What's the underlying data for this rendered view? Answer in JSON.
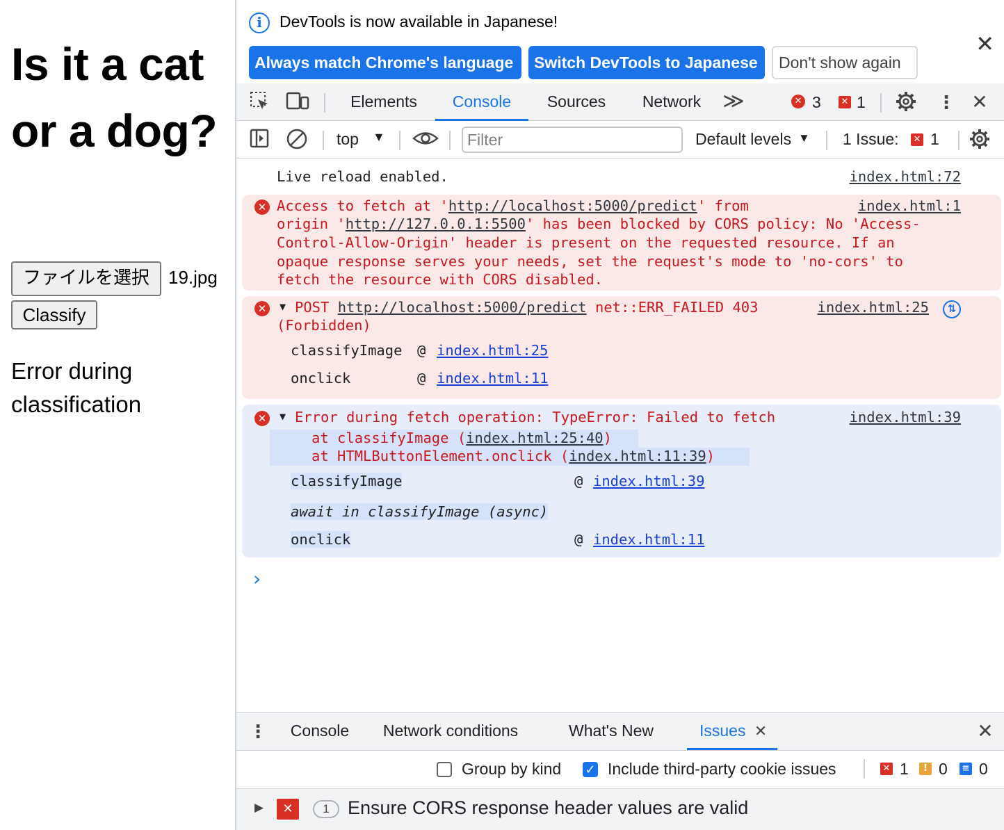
{
  "page": {
    "heading": "Is it a cat or a dog?",
    "file_button": "ファイルを選択",
    "file_name": "19.jpg",
    "classify_button": "Classify",
    "result": "Error during classification"
  },
  "infobar": {
    "message": "DevTools is now available in Japanese!",
    "btn_match": "Always match Chrome's language",
    "btn_switch": "Switch DevTools to Japanese",
    "btn_dont_show": "Don't show again"
  },
  "main_tabs": {
    "elements": "Elements",
    "console": "Console",
    "sources": "Sources",
    "network": "Network",
    "more": "≫",
    "error_count": "3",
    "issue_count": "1"
  },
  "console_toolbar": {
    "context": "top",
    "filter_placeholder": "Filter",
    "levels": "Default levels",
    "issues_label": "1 Issue:",
    "issues_count": "1"
  },
  "console": {
    "live_reload": "Live reload enabled.",
    "live_reload_src": "index.html:72",
    "cors": {
      "src": "index.html:1",
      "l1a": "Access to fetch at '",
      "l1url": "http://localhost:5000/predict",
      "l1b": "' from",
      "l2a": "origin '",
      "l2url": "http://127.0.0.1:5500",
      "l2b": "' has been blocked by CORS policy: No 'Access-",
      "l3": "Control-Allow-Origin' header is present on the requested resource. If an",
      "l4": "opaque response serves your needs, set the request's mode to 'no-cors' to",
      "l5": "fetch the resource with CORS disabled."
    },
    "post": {
      "method": "POST",
      "url": "http://localhost:5000/predict",
      "status": "net::ERR_FAILED 403",
      "status2": "(Forbidden)",
      "src": "index.html:25",
      "stack": [
        {
          "fn": "classifyImage",
          "at": "@",
          "link": "index.html:25"
        },
        {
          "fn": "onclick",
          "at": "@",
          "link": "index.html:11"
        }
      ]
    },
    "fetch_error": {
      "title": "Error during fetch operation: TypeError: Failed to fetch",
      "src": "index.html:39",
      "at1a": "at classifyImage (",
      "at1link": "index.html:25:40",
      "at1b": ")",
      "at2a": "at HTMLButtonElement.onclick (",
      "at2link": "index.html:11:39",
      "at2b": ")",
      "stack": [
        {
          "fn": "classifyImage",
          "at": "@",
          "link": "index.html:39"
        },
        {
          "fn": "await in classifyImage (async)"
        },
        {
          "fn": "onclick",
          "at": "@",
          "link": "index.html:11"
        }
      ]
    },
    "prompt": "›"
  },
  "drawer": {
    "tabs": {
      "console": "Console",
      "network_conditions": "Network conditions",
      "whats_new": "What's New",
      "issues": "Issues"
    },
    "group_by_kind": "Group by kind",
    "include_third_party": "Include third-party cookie issues",
    "count_errors": "1",
    "count_warnings": "0",
    "count_info": "0",
    "issue_badge": "1",
    "issue_title": "Ensure CORS response header values are valid"
  },
  "colors": {
    "accent": "#1a73e8",
    "error": "#c9181e",
    "error_bg": "#fbe9e8",
    "selected_bg": "#e8eef9"
  }
}
